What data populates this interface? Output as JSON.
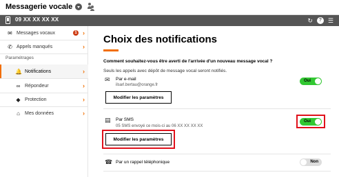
{
  "app": {
    "title": "Messagerie vocale",
    "phone_number": "09 XX XX XX XX"
  },
  "toolbar_icons": [
    "refresh-icon",
    "help-icon",
    "menu-icon"
  ],
  "sidebar": {
    "items": [
      {
        "label": "Messages vocaux",
        "icon": "voicemail-icon",
        "badge": "1"
      },
      {
        "label": "Appels manqués",
        "icon": "missed-call-icon"
      }
    ],
    "section_label": "Paramétrages",
    "settings": [
      {
        "label": "Notifications",
        "icon": "bell-icon",
        "active": true
      },
      {
        "label": "Répondeur",
        "icon": "answering-machine-icon"
      },
      {
        "label": "Protection",
        "icon": "shield-icon"
      },
      {
        "label": "Mes données",
        "icon": "home-icon"
      }
    ]
  },
  "main": {
    "title": "Choix des notifications",
    "question": "Comment souhaitez-vous être averti de l'arrivée d'un nouveau message vocal ?",
    "info": "Seuls les appels avec dépôt de message vocal seront notifiés.",
    "options": [
      {
        "icon": "envelope-icon",
        "title": "Par e-mail",
        "detail": "ilsarl.bertau@orange.fr",
        "toggle": "Oui",
        "toggle_on": true,
        "button": "Modifier les paramètres"
      },
      {
        "icon": "sms-icon",
        "title": "Par SMS",
        "detail": "05 SMS envoyé ce mois-ci au 06 XX XX XX XX",
        "toggle": "Oui",
        "toggle_on": true,
        "button": "Modifier les paramètres"
      },
      {
        "icon": "landline-phone-icon",
        "title": "Par un rappel téléphonique",
        "toggle": "Non",
        "toggle_on": false
      }
    ]
  },
  "colors": {
    "accent": "#f16e00",
    "toggle_on": "#32c832",
    "highlight": "#e0101a",
    "phonebar": "#555555"
  }
}
